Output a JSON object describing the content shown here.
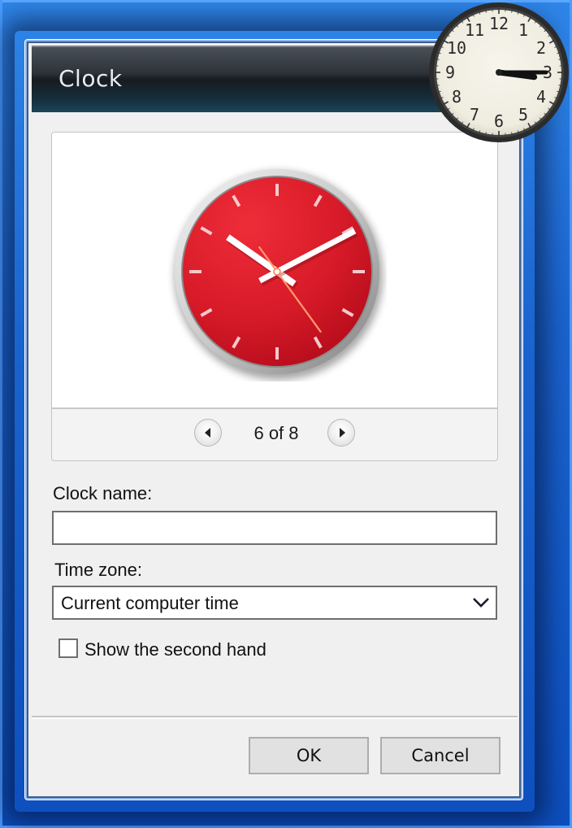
{
  "window": {
    "title": "Clock"
  },
  "preview": {
    "clock_style_index": 6,
    "clock_style_total": 8,
    "counter_text": "6 of 8",
    "prev_icon": "triangle-left-icon",
    "next_icon": "triangle-right-icon",
    "time_shown": {
      "hour": 10,
      "minute": 10,
      "second": 24
    },
    "colors": {
      "face": "#d41c2a",
      "hands": "#ffffff",
      "second_hand": "#ff9a70",
      "rim": "#c8c8c8"
    }
  },
  "form": {
    "clock_name_label": "Clock name:",
    "clock_name_value": "",
    "time_zone_label": "Time zone:",
    "time_zone_value": "Current computer time",
    "time_zone_icon": "chevron-down-icon",
    "show_second_hand_label": "Show the second hand",
    "show_second_hand_checked": false
  },
  "buttons": {
    "ok": "OK",
    "cancel": "Cancel"
  },
  "desktop_gadget": {
    "numerals": [
      "12",
      "1",
      "2",
      "3",
      "4",
      "5",
      "6",
      "7",
      "8",
      "9",
      "10",
      "11"
    ],
    "time_shown": {
      "hour": 3,
      "minute": 15
    },
    "colors": {
      "face": "#f2efe2",
      "rim": "#2a2a2a",
      "hands": "#111111"
    }
  }
}
